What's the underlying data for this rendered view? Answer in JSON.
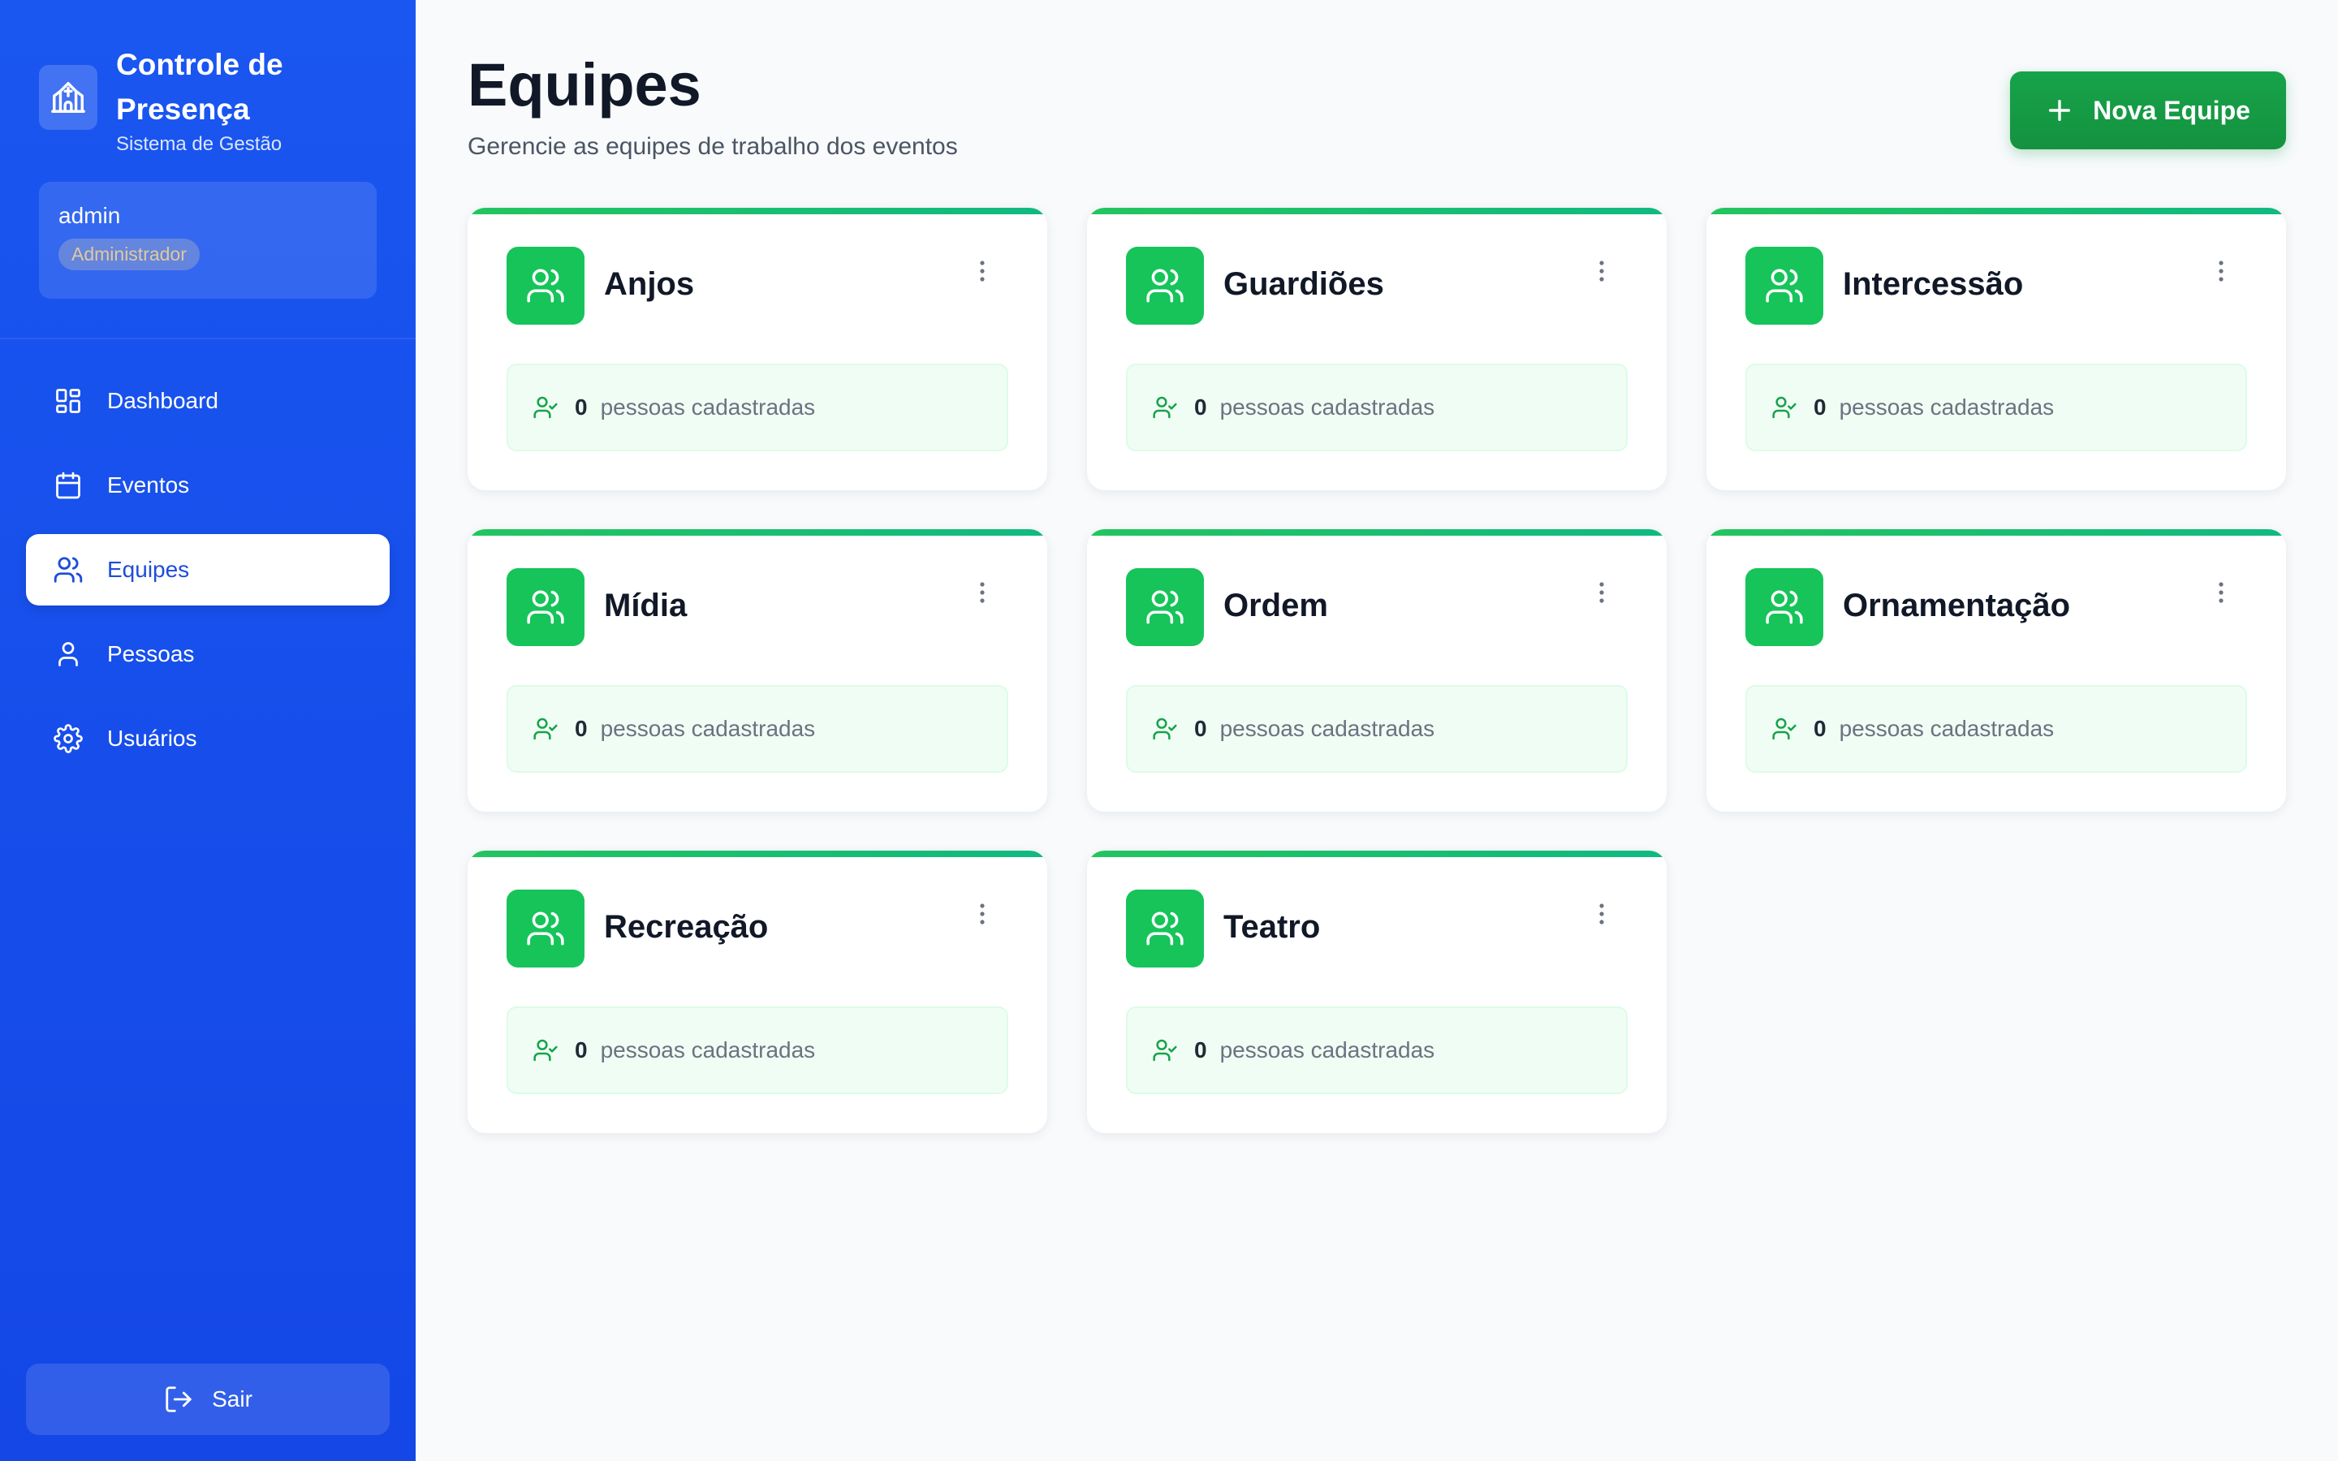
{
  "sidebar": {
    "brand_title": "Controle de Presença",
    "brand_subtitle": "Sistema de Gestão",
    "user": {
      "name": "admin",
      "role": "Administrador"
    },
    "nav": [
      {
        "label": "Dashboard",
        "icon": "dashboard-icon"
      },
      {
        "label": "Eventos",
        "icon": "calendar-icon"
      },
      {
        "label": "Equipes",
        "icon": "users-icon",
        "active": true
      },
      {
        "label": "Pessoas",
        "icon": "user-icon"
      },
      {
        "label": "Usuários",
        "icon": "gear-icon"
      }
    ],
    "logout_label": "Sair"
  },
  "header": {
    "title": "Equipes",
    "subtitle": "Gerencie as equipes de trabalho dos eventos",
    "new_button_label": "Nova Equipe"
  },
  "teams": [
    {
      "name": "Anjos",
      "count": "0",
      "count_label": "pessoas cadastradas"
    },
    {
      "name": "Guardiões",
      "count": "0",
      "count_label": "pessoas cadastradas"
    },
    {
      "name": "Intercessão",
      "count": "0",
      "count_label": "pessoas cadastradas"
    },
    {
      "name": "Mídia",
      "count": "0",
      "count_label": "pessoas cadastradas"
    },
    {
      "name": "Ordem",
      "count": "0",
      "count_label": "pessoas cadastradas"
    },
    {
      "name": "Ornamentação",
      "count": "0",
      "count_label": "pessoas cadastradas"
    },
    {
      "name": "Recreação",
      "count": "0",
      "count_label": "pessoas cadastradas"
    },
    {
      "name": "Teatro",
      "count": "0",
      "count_label": "pessoas cadastradas"
    }
  ],
  "colors": {
    "sidebar": "#1a56f0",
    "accent_green": "#16a34a",
    "team_icon_bg": "#16c45a",
    "stat_bg": "#f0fdf4"
  }
}
